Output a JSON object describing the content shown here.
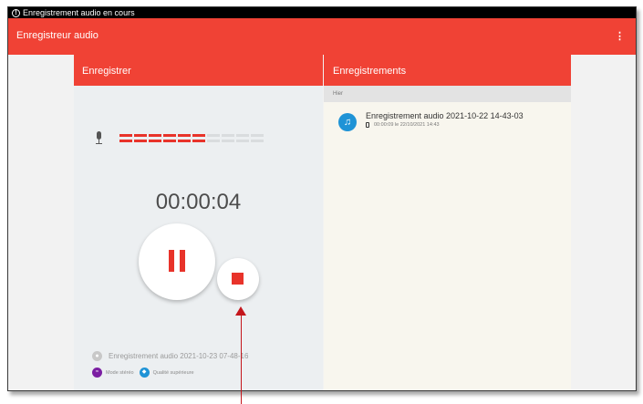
{
  "status_bar": {
    "alert_glyph": "!",
    "text": "Enregistrement audio en cours"
  },
  "app_bar": {
    "title": "Enregistreur audio",
    "menu_glyph": "⋮"
  },
  "record_panel": {
    "title": "Enregistrer",
    "level_on": 6,
    "level_total": 10,
    "timer": "00:00:04",
    "current_file": "Enregistrement audio 2021-10-23 07-48-16",
    "file_glyph": "●",
    "stereo_label": "Mode stéréo",
    "stereo_color": "#7b1fa2",
    "quality_label": "Qualité supérieure",
    "quality_color": "#1f93d6"
  },
  "recordings_panel": {
    "title": "Enregistrements",
    "section": "Hier",
    "items": [
      {
        "title": "Enregistrement audio 2021-10-22 14-43-03",
        "meta": "00:00:09 le 22/10/2021 14:43",
        "icon": "♫"
      }
    ]
  },
  "colors": {
    "accent": "#f04235",
    "record_red": "#e8332a",
    "annotation_arrow": "#c4161c"
  }
}
